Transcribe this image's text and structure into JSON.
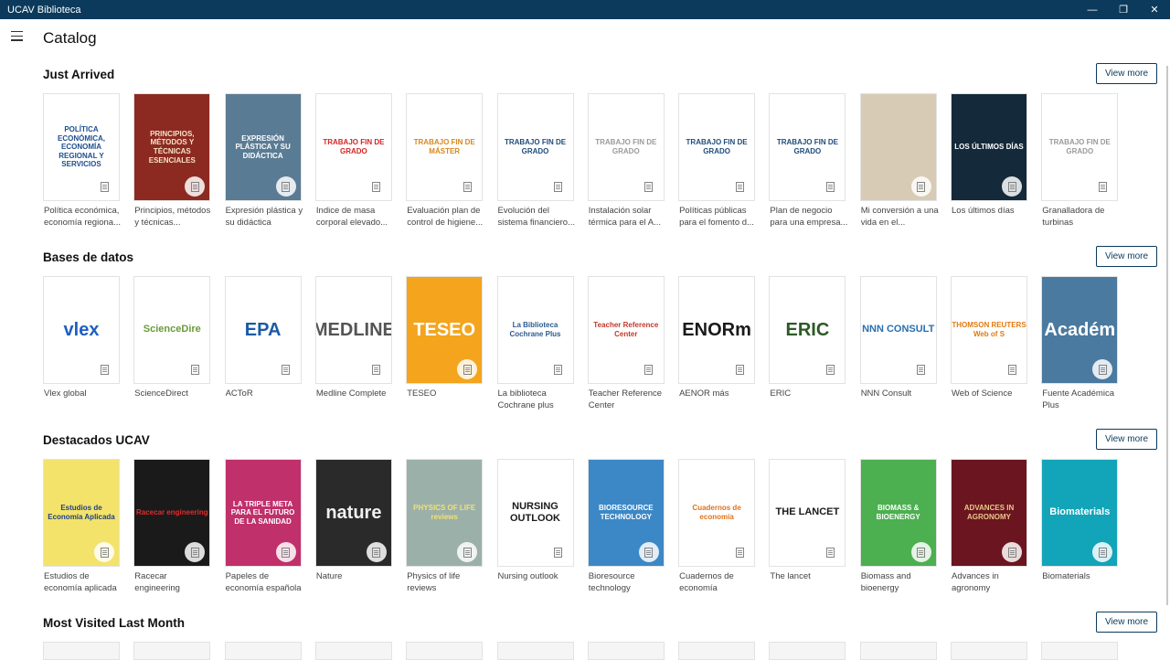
{
  "window": {
    "title": "UCAV Biblioteca",
    "minimize": "—",
    "maximize": "❐",
    "close": "✕"
  },
  "header": {
    "title": "Catalog"
  },
  "sections": [
    {
      "title": "Just Arrived",
      "view_more": "View more",
      "items": [
        {
          "label": "Política económica, economía regiona...",
          "cover_text": "POLÍTICA ECONÓMICA, ECONOMÍA REGIONAL Y SERVICIOS",
          "bg": "#ffffff",
          "fg": "#1d4e8f"
        },
        {
          "label": "Principios, métodos y técnicas...",
          "cover_text": "PRINCIPIOS, MÉTODOS Y TÉCNICAS ESENCIALES",
          "bg": "#8c2a22",
          "fg": "#f6e3c4"
        },
        {
          "label": "Expresión plástica y su didáctica",
          "cover_text": "EXPRESIÓN PLÁSTICA Y SU DIDÁCTICA",
          "bg": "#5a7b94",
          "fg": "#ffffff"
        },
        {
          "label": "Indice de masa corporal elevado...",
          "cover_text": "TRABAJO FIN DE GRADO",
          "bg": "#ffffff",
          "fg": "#d42424"
        },
        {
          "label": "Evaluación plan de control de higiene...",
          "cover_text": "TRABAJO FIN DE MÁSTER",
          "bg": "#ffffff",
          "fg": "#d9871b"
        },
        {
          "label": "Evolución del sistema financiero...",
          "cover_text": "TRABAJO FIN DE GRADO",
          "bg": "#ffffff",
          "fg": "#1e4c7a"
        },
        {
          "label": "Instalación solar térmica para el A...",
          "cover_text": "TRABAJO FIN DE GRADO",
          "bg": "#ffffff",
          "fg": "#9a9a9a"
        },
        {
          "label": "Políticas públicas para el fomento d...",
          "cover_text": "TRABAJO FIN DE GRADO",
          "bg": "#ffffff",
          "fg": "#1e4c7a"
        },
        {
          "label": "Plan de negocio para una empresa...",
          "cover_text": "TRABAJO FIN DE GRADO",
          "bg": "#ffffff",
          "fg": "#1e4c7a"
        },
        {
          "label": "Mi conversión a una vida en el...",
          "cover_text": "",
          "bg": "#d8cbb5",
          "fg": "#8a7a60"
        },
        {
          "label": "Los últimos días",
          "cover_text": "LOS ÚLTIMOS DÍAS",
          "bg": "#142a3a",
          "fg": "#ffffff"
        },
        {
          "label": "Granalladora de turbinas",
          "cover_text": "TRABAJO FIN DE GRADO",
          "bg": "#ffffff",
          "fg": "#9a9a9a"
        }
      ]
    },
    {
      "title": "Bases de datos",
      "view_more": "View more",
      "items": [
        {
          "label": "Vlex global",
          "cover_text": "vlex",
          "bg": "#ffffff",
          "fg": "#1f5fbf"
        },
        {
          "label": "ScienceDirect",
          "cover_text": "ScienceDire",
          "bg": "#ffffff",
          "fg": "#6a9a3a"
        },
        {
          "label": "ACToR",
          "cover_text": "EPA",
          "bg": "#ffffff",
          "fg": "#1b5aa6"
        },
        {
          "label": "Medline Complete",
          "cover_text": "MEDLINE",
          "bg": "#ffffff",
          "fg": "#555555"
        },
        {
          "label": "TESEO",
          "cover_text": "TESEO",
          "bg": "#f4a51d",
          "fg": "#ffffff"
        },
        {
          "label": "La biblioteca Cochrane plus",
          "cover_text": "La Biblioteca Cochrane Plus",
          "bg": "#ffffff",
          "fg": "#2b5b8f"
        },
        {
          "label": "Teacher Reference Center",
          "cover_text": "Teacher Reference Center",
          "bg": "#ffffff",
          "fg": "#c0392b"
        },
        {
          "label": "AENOR más",
          "cover_text": "ENORm",
          "bg": "#ffffff",
          "fg": "#1a1a1a"
        },
        {
          "label": "ERIC",
          "cover_text": "ERIC",
          "bg": "#ffffff",
          "fg": "#2d5a27"
        },
        {
          "label": "NNN Consult",
          "cover_text": "NNN CONSULT",
          "bg": "#ffffff",
          "fg": "#2a6fb0"
        },
        {
          "label": "Web of Science",
          "cover_text": "THOMSON REUTERS Web of S",
          "bg": "#ffffff",
          "fg": "#e07a10"
        },
        {
          "label": "Fuente Académica Plus",
          "cover_text": "Académ",
          "bg": "#4a7aa0",
          "fg": "#ffffff"
        }
      ]
    },
    {
      "title": "Destacados UCAV",
      "view_more": "View more",
      "items": [
        {
          "label": "Estudios de economía aplicada",
          "cover_text": "Estudios de Economía Aplicada",
          "bg": "#f3e36a",
          "fg": "#1f3f8a"
        },
        {
          "label": "Racecar engineering",
          "cover_text": "Racecar engineering",
          "bg": "#1a1a1a",
          "fg": "#e12b2b"
        },
        {
          "label": "Papeles de economía española",
          "cover_text": "LA TRIPLE META PARA EL FUTURO DE LA SANIDAD",
          "bg": "#c0306b",
          "fg": "#ffffff"
        },
        {
          "label": "Nature",
          "cover_text": "nature",
          "bg": "#2a2a2a",
          "fg": "#f0f0f0"
        },
        {
          "label": "Physics of life reviews",
          "cover_text": "PHYSICS OF LIFE reviews",
          "bg": "#9bb0a8",
          "fg": "#f2e07a"
        },
        {
          "label": "Nursing outlook",
          "cover_text": "NURSING OUTLOOK",
          "bg": "#ffffff",
          "fg": "#1a1a1a"
        },
        {
          "label": "Bioresource technology",
          "cover_text": "BIORESOURCE TECHNOLOGY",
          "bg": "#3c88c6",
          "fg": "#ffffff"
        },
        {
          "label": "Cuadernos de economía",
          "cover_text": "Cuadernos de economía",
          "bg": "#ffffff",
          "fg": "#e0731b"
        },
        {
          "label": "The lancet",
          "cover_text": "THE LANCET",
          "bg": "#ffffff",
          "fg": "#1a1a1a"
        },
        {
          "label": "Biomass and bioenergy",
          "cover_text": "BIOMASS & BIOENERGY",
          "bg": "#4caf50",
          "fg": "#ffffff"
        },
        {
          "label": "Advances in agronomy",
          "cover_text": "ADVANCES IN AGRONOMY",
          "bg": "#6b1520",
          "fg": "#e8c98a"
        },
        {
          "label": "Biomaterials",
          "cover_text": "Biomaterials",
          "bg": "#12a4b8",
          "fg": "#ffffff"
        }
      ]
    },
    {
      "title": "Most Visited Last Month",
      "view_more": "View more",
      "items": []
    }
  ],
  "colors": {
    "titlebar": "#0b3a5c",
    "accent": "#0b3a5c"
  },
  "icons": {
    "menu": "hamburger-icon",
    "doc": "document-icon"
  }
}
